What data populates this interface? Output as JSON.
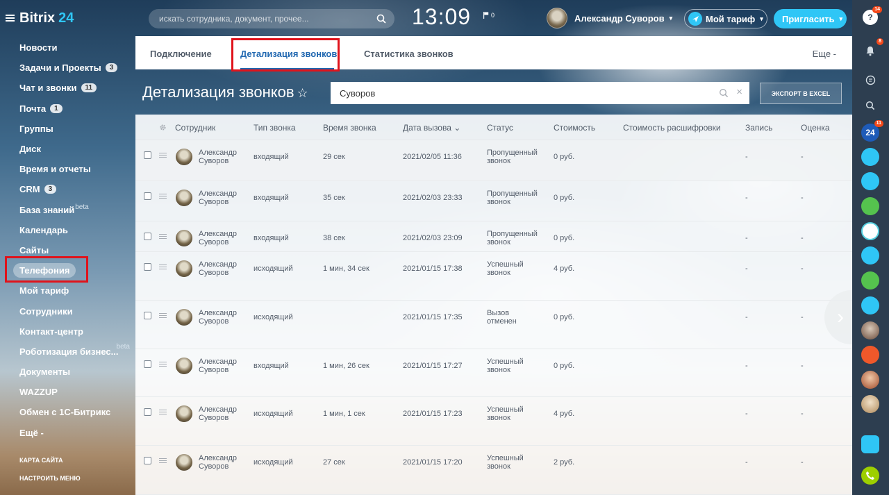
{
  "app": {
    "logo_text": "Bitrix",
    "logo_num": "24"
  },
  "header": {
    "search_placeholder": "искать сотрудника, документ, прочее...",
    "clock": "13:09",
    "flag_count": "0",
    "user_name": "Александр Суворов",
    "tariff_label": "Мой тариф",
    "invite_label": "Пригласить"
  },
  "sidebar": {
    "items": [
      {
        "label": "Новости"
      },
      {
        "label": "Задачи и Проекты",
        "badge": "3"
      },
      {
        "label": "Чат и звонки",
        "badge": "11"
      },
      {
        "label": "Почта",
        "badge": "1"
      },
      {
        "label": "Группы"
      },
      {
        "label": "Диск"
      },
      {
        "label": "Время и отчеты"
      },
      {
        "label": "CRM",
        "badge": "3"
      },
      {
        "label": "База знаний",
        "sup": "beta"
      },
      {
        "label": "Календарь"
      },
      {
        "label": "Сайты"
      },
      {
        "label": "Телефония"
      },
      {
        "label": "Мой тариф"
      },
      {
        "label": "Сотрудники"
      },
      {
        "label": "Контакт-центр"
      },
      {
        "label": "Роботизация бизнес...",
        "beta": "beta"
      },
      {
        "label": "Документы"
      },
      {
        "label": "WAZZUP"
      },
      {
        "label": "Обмен с 1С-Битрикс"
      },
      {
        "label": "Ещё -"
      }
    ],
    "links": [
      "Карта сайта",
      "Настроить меню"
    ]
  },
  "tabs": {
    "items": [
      "Подключение",
      "Детализация звонков",
      "Статистика звонков"
    ],
    "more": "Еще -"
  },
  "page": {
    "title": "Детализация звонков",
    "filter_value": "Суворов",
    "export_label": "Экспорт в Excel"
  },
  "grid": {
    "headers": [
      "Сотрудник",
      "Тип звонка",
      "Время звонка",
      "Дата вызова",
      "Статус",
      "Стоимость",
      "Стоимость расшифровки",
      "Запись",
      "Оценка"
    ],
    "sort_indicator": "⌄",
    "rows": [
      {
        "first": "Александр",
        "last": "Суворов",
        "type": "входящий",
        "duration": "29 сек",
        "date": "2021/02/05 11:36",
        "status1": "Пропущенный",
        "status2": "звонок",
        "cost": "0 руб.",
        "rec": "-",
        "rate": "-"
      },
      {
        "first": "Александр",
        "last": "Суворов",
        "type": "входящий",
        "duration": "35 сек",
        "date": "2021/02/03 23:33",
        "status1": "Пропущенный",
        "status2": "звонок",
        "cost": "0 руб.",
        "rec": "-",
        "rate": "-"
      },
      {
        "first": "Александр",
        "last": "Суворов",
        "type": "входящий",
        "duration": "38 сек",
        "date": "2021/02/03 23:09",
        "status1": "Пропущенный",
        "status2": "звонок",
        "cost": "0 руб.",
        "rec": "-",
        "rate": "-"
      },
      {
        "first": "Александр",
        "last": "Суворов",
        "type": "исходящий",
        "duration": "1 мин, 34 сек",
        "date": "2021/01/15 17:38",
        "status1": "Успешный",
        "status2": "звонок",
        "cost": "4 руб.",
        "rec": "-",
        "rate": "-"
      },
      {
        "first": "Александр",
        "last": "Суворов",
        "type": "исходящий",
        "duration": "",
        "date": "2021/01/15 17:35",
        "status1": "Вызов",
        "status2": "отменен",
        "cost": "0 руб.",
        "rec": "-",
        "rate": "-"
      },
      {
        "first": "Александр",
        "last": "Суворов",
        "type": "входящий",
        "duration": "1 мин, 26 сек",
        "date": "2021/01/15 17:27",
        "status1": "Успешный",
        "status2": "звонок",
        "cost": "0 руб.",
        "rec": "-",
        "rate": "-"
      },
      {
        "first": "Александр",
        "last": "Суворов",
        "type": "исходящий",
        "duration": "1 мин, 1 сек",
        "date": "2021/01/15 17:23",
        "status1": "Успешный",
        "status2": "звонок",
        "cost": "4 руб.",
        "rec": "-",
        "rate": "-"
      },
      {
        "first": "Александр",
        "last": "Суворов",
        "type": "исходящий",
        "duration": "27 сек",
        "date": "2021/01/15 17:20",
        "status1": "Успешный",
        "status2": "звонок",
        "cost": "2 руб.",
        "rec": "-",
        "rate": "-"
      }
    ]
  },
  "rightbar": {
    "help_badge": "14",
    "notif_badge": "8",
    "b24_label": "24",
    "b24_badge": "11",
    "colors": {
      "accent": "#2fc6f6",
      "green": "#55d0e0",
      "call": "#9dcf00"
    }
  }
}
